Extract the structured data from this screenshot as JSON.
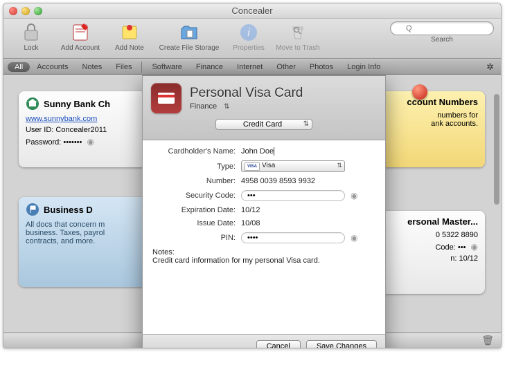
{
  "app": {
    "title": "Concealer"
  },
  "toolbar": {
    "items": [
      {
        "id": "lock",
        "label": "Lock"
      },
      {
        "id": "add-account",
        "label": "Add Account"
      },
      {
        "id": "add-note",
        "label": "Add Note"
      },
      {
        "id": "create-file-storage",
        "label": "Create File Storage"
      },
      {
        "id": "properties",
        "label": "Properties"
      },
      {
        "id": "move-to-trash",
        "label": "Move to Trash"
      }
    ],
    "search_label": "Search",
    "search_placeholder": "Q"
  },
  "filters": {
    "all": "All",
    "items": [
      "Accounts",
      "Notes",
      "Files",
      "Software",
      "Finance",
      "Internet",
      "Other",
      "Photos",
      "Login Info"
    ]
  },
  "cards": {
    "bank": {
      "title": "Sunny Bank Ch",
      "url": "www.sunnybank.com",
      "user_label": "User ID:",
      "user_value": "Concealer2011",
      "pw_label": "Password:",
      "pw_value": "•••••••"
    },
    "acct_numbers": {
      "title": "ccount Numbers",
      "line1": "numbers for",
      "line2": "ank accounts."
    },
    "business": {
      "title": "Business D",
      "body": "All docs that concern m\nbusiness. Taxes, payrol\ncontracts, and more."
    },
    "master": {
      "title": "ersonal Master...",
      "number": "0 5322 8890",
      "code_label": "Code:",
      "code_value": "•••",
      "exp_label": "n:",
      "exp_value": "10/12"
    }
  },
  "modal": {
    "title": "Personal Visa Card",
    "category": "Finance",
    "subtype": "Credit Card",
    "fields": {
      "cardholder_label": "Cardholder's Name:",
      "cardholder_value": "John Doe",
      "type_label": "Type:",
      "type_value": "Visa",
      "number_label": "Number:",
      "number_value": "4958 0039 8593 9932",
      "seccode_label": "Security Code:",
      "seccode_value": "•••",
      "exp_label": "Expiration Date:",
      "exp_value": "10/12",
      "issue_label": "Issue Date:",
      "issue_value": "10/08",
      "pin_label": "PIN:",
      "pin_value": "••••"
    },
    "notes_label": "Notes:",
    "notes_value": "Credit card information for my personal Visa card.",
    "cancel": "Cancel",
    "save": "Save Changes"
  }
}
